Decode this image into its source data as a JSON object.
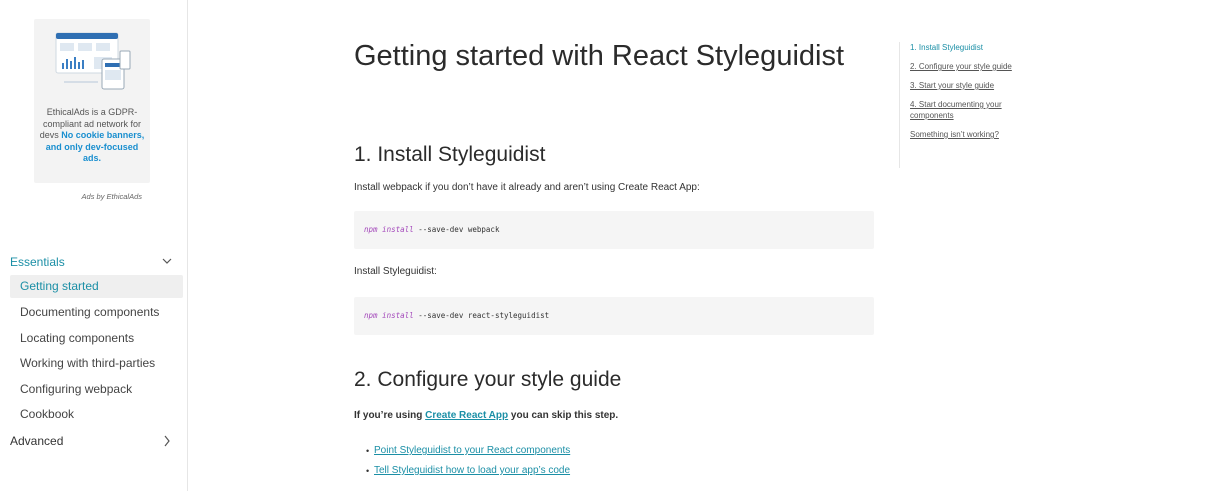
{
  "ad": {
    "text_plain": "EthicalAds is a GDPR-compliant ad network for devs",
    "text_bold": "No cookie banners, and only dev-focused ads.",
    "attribution": "Ads by EthicalAds"
  },
  "nav": {
    "sections": [
      {
        "label": "Essentials",
        "expanded": true,
        "items": [
          {
            "label": "Getting started",
            "active": true
          },
          {
            "label": "Documenting components"
          },
          {
            "label": "Locating components"
          },
          {
            "label": "Working with third-parties"
          },
          {
            "label": "Configuring webpack"
          },
          {
            "label": "Cookbook"
          }
        ]
      },
      {
        "label": "Advanced",
        "expanded": false
      }
    ]
  },
  "main": {
    "title": "Getting started with React Styleguidist",
    "section1": {
      "heading": "1. Install Styleguidist",
      "intro": "Install webpack if you don’t have it already and aren’t using Create React App:",
      "code1": {
        "keyword": "npm install",
        "rest": "--save-dev webpack"
      },
      "install_label": "Install Styleguidist:",
      "code2": {
        "keyword": "npm install",
        "rest": "--save-dev react-styleguidist"
      }
    },
    "section2": {
      "heading": "2. Configure your style guide",
      "note_prefix": "If you’re using ",
      "note_link": "Create React App",
      "note_suffix": " you can skip this step.",
      "links": [
        "Point Styleguidist to your React components",
        "Tell Styleguidist how to load your app’s code"
      ]
    }
  },
  "toc": {
    "items": [
      {
        "label": "1. Install Styleguidist",
        "active": true
      },
      {
        "label": "2. Configure your style guide"
      },
      {
        "label": "3. Start your style guide"
      },
      {
        "label": "4. Start documenting your components"
      },
      {
        "label": "Something isn’t working?"
      }
    ]
  },
  "colors": {
    "accent": "#1b8fa6",
    "ad_bold": "#1a8fcf",
    "code_keyword": "#a347ba",
    "code_bg": "#f5f5f5",
    "active_nav_bg": "#efefef"
  }
}
